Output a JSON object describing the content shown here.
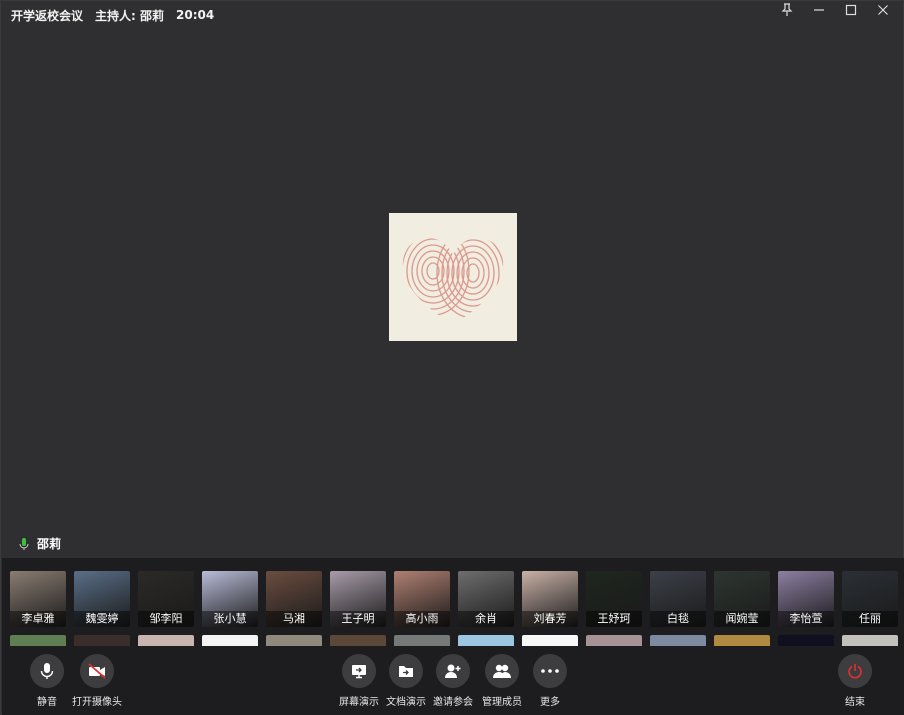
{
  "title_bar": {
    "meeting_name": "开学返校会议",
    "host": "主持人: 邵莉",
    "time": "20:04"
  },
  "window_controls": [
    "pin-icon",
    "minimize-icon",
    "maximize-icon",
    "close-icon"
  ],
  "active_speaker": {
    "name": "邵莉",
    "icon": "mic-icon"
  },
  "main_video": {
    "content": "fingerprint-heart-image"
  },
  "participants": [
    {
      "name": "李卓雅",
      "color": "#8a7d72"
    },
    {
      "name": "魏雯婷",
      "color": "#5a6f88"
    },
    {
      "name": "邹李阳",
      "color": "#2b2a27"
    },
    {
      "name": "张小慧",
      "color": "#b9bcd8"
    },
    {
      "name": "马湘",
      "color": "#6b4d40"
    },
    {
      "name": "王子明",
      "color": "#a89ca8"
    },
    {
      "name": "高小雨",
      "color": "#b08072"
    },
    {
      "name": "余肖",
      "color": "#6e6e6e"
    },
    {
      "name": "刘春芳",
      "color": "#c9b1a6"
    },
    {
      "name": "王妤珂",
      "color": "#1f261f"
    },
    {
      "name": "白毯",
      "color": "#3c4048"
    },
    {
      "name": "闻婉莹",
      "color": "#2e3631"
    },
    {
      "name": "李怡萱",
      "color": "#8d7fa2"
    },
    {
      "name": "任丽",
      "color": "#2b3036"
    }
  ],
  "participants_row2_colors": [
    "#5f7e52",
    "#3a2e2a",
    "#c9b5b0",
    "#f4f4f4",
    "#8f8a7c",
    "#5b4838",
    "#757a78",
    "#9cc7e0",
    "#f8f8f8",
    "#a79396",
    "#7e8aa0",
    "#b08a3e",
    "#0e1020",
    "#c4c0ba"
  ],
  "toolbar": {
    "mute": {
      "label": "静音",
      "icon": "mic-icon"
    },
    "camera": {
      "label": "打开摄像头",
      "icon": "camera-off-icon"
    },
    "screen_share": {
      "label": "屏幕演示",
      "icon": "screen-share-icon"
    },
    "doc_share": {
      "label": "文档演示",
      "icon": "document-icon"
    },
    "invite": {
      "label": "邀请参会",
      "icon": "add-person-icon"
    },
    "manage": {
      "label": "管理成员",
      "icon": "members-icon"
    },
    "more": {
      "label": "更多",
      "icon": "more-icon"
    },
    "end": {
      "label": "结束",
      "icon": "power-icon",
      "color": "#e0302f"
    }
  }
}
